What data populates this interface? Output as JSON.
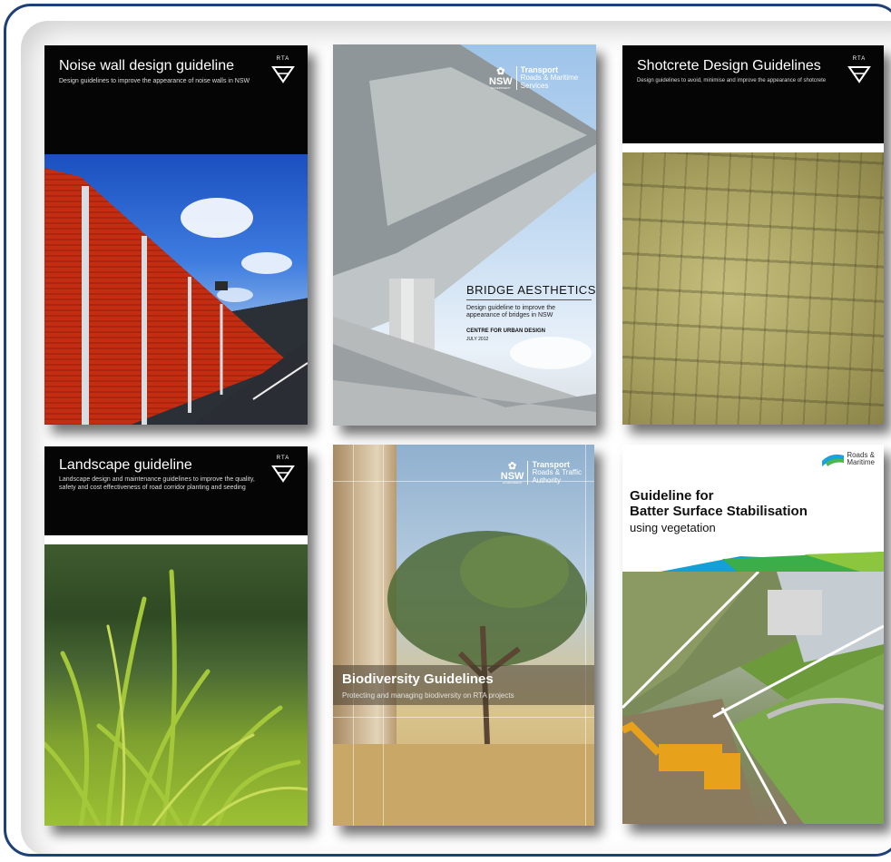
{
  "covers": {
    "noise": {
      "title": "Noise wall design guideline",
      "subtitle": "Design guidelines to improve the appearance of noise walls in NSW",
      "logo": "RTA"
    },
    "bridge": {
      "title": "BRIDGE AESTHETICS",
      "subtitle": "Design guideline to improve the appearance of bridges in NSW",
      "centre": "CENTRE FOR URBAN DESIGN",
      "date": "JULY 2012",
      "logo_nsw": "NSW",
      "logo_gov": "GOVERNMENT",
      "logo_transport": "Transport",
      "logo_agency_1": "Roads & Maritime",
      "logo_agency_2": "Services"
    },
    "shotcrete": {
      "title": "Shotcrete Design Guidelines",
      "subtitle": "Design guidelines to avoid, minimise and improve the appearance of shotcrete",
      "logo": "RTA"
    },
    "landscape": {
      "title": "Landscape guideline",
      "subtitle_1": "Landscape design and maintenance guidelines to improve the quality,",
      "subtitle_2": "safety and cost effectiveness of road corridor planting and seeding",
      "logo": "RTA"
    },
    "biodiversity": {
      "title": "Biodiversity Guidelines",
      "subtitle": "Protecting and managing biodiversity on RTA projects",
      "logo_nsw": "NSW",
      "logo_gov": "GOVERNMENT",
      "logo_transport": "Transport",
      "logo_agency_1": "Roads & Traffic",
      "logo_agency_2": "Authority"
    },
    "batter": {
      "title_1": "Guideline for",
      "title_2": "Batter Surface Stabilisation",
      "title_3": "using vegetation",
      "logo_1": "Roads &",
      "logo_2": "Maritime"
    }
  }
}
